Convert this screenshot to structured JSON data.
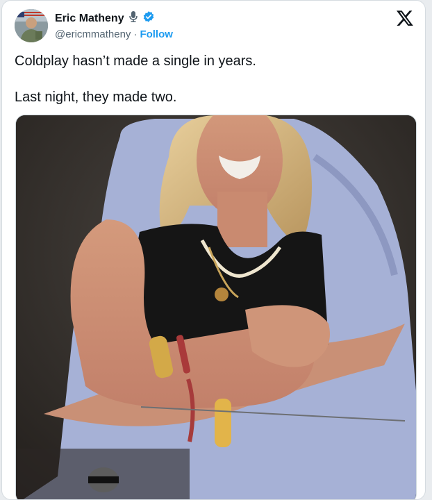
{
  "tweet": {
    "author_name": "Eric Matheny",
    "handle": "@ericmmatheny",
    "separator": "·",
    "follow_label": "Follow",
    "text_lines": [
      "Coldplay hasn’t made a single in years.",
      "Last night, they made two."
    ]
  },
  "icons": {
    "logo": "x-logo-icon",
    "affiliate": "microphone-badge-icon",
    "verified": "verified-badge-icon",
    "verified_color": "#1d9bf0"
  },
  "media": {
    "kind": "photo"
  }
}
